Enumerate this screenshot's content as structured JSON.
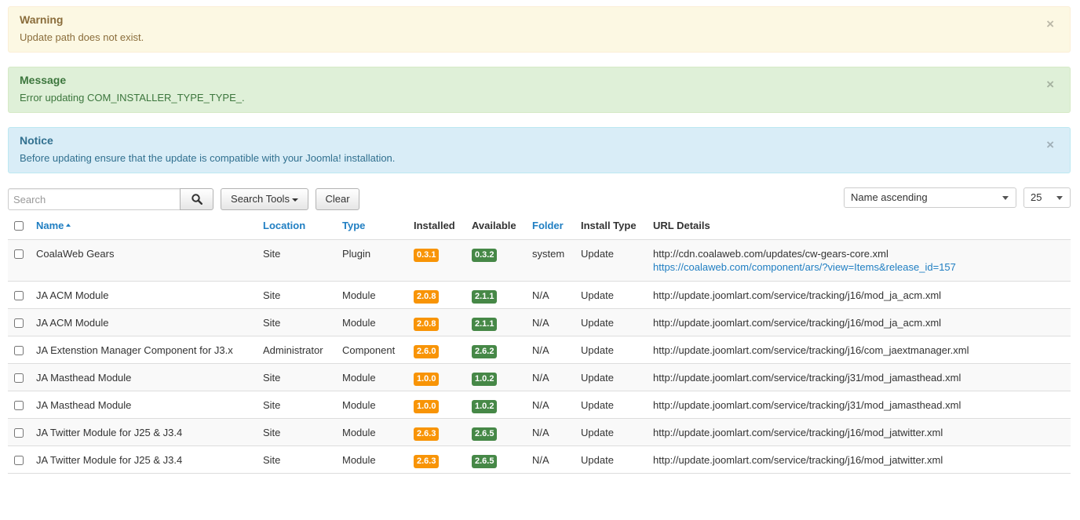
{
  "alerts": {
    "warning": {
      "title": "Warning",
      "text": "Update path does not exist.",
      "close": "×"
    },
    "message": {
      "title": "Message",
      "text": "Error updating COM_INSTALLER_TYPE_TYPE_.",
      "close": "×"
    },
    "notice": {
      "title": "Notice",
      "text": "Before updating ensure that the update is compatible with your Joomla! installation.",
      "close": "×"
    }
  },
  "toolbar": {
    "search_placeholder": "Search",
    "search_tools_label": "Search Tools",
    "clear_label": "Clear",
    "ordering_value": "Name ascending",
    "limit_value": "25"
  },
  "table": {
    "headers": {
      "name": "Name",
      "location": "Location",
      "type": "Type",
      "installed": "Installed",
      "available": "Available",
      "folder": "Folder",
      "install_type": "Install Type",
      "url_details": "URL Details"
    },
    "rows": [
      {
        "name": "CoalaWeb Gears",
        "location": "Site",
        "type": "Plugin",
        "installed": "0.3.1",
        "available": "0.3.2",
        "folder": "system",
        "install_type": "Update",
        "url": "http://cdn.coalaweb.com/updates/cw-gears-core.xml",
        "url2": "https://coalaweb.com/component/ars/?view=Items&release_id=157"
      },
      {
        "name": "JA ACM Module",
        "location": "Site",
        "type": "Module",
        "installed": "2.0.8",
        "available": "2.1.1",
        "folder": "N/A",
        "install_type": "Update",
        "url": "http://update.joomlart.com/service/tracking/j16/mod_ja_acm.xml"
      },
      {
        "name": "JA ACM Module",
        "location": "Site",
        "type": "Module",
        "installed": "2.0.8",
        "available": "2.1.1",
        "folder": "N/A",
        "install_type": "Update",
        "url": "http://update.joomlart.com/service/tracking/j16/mod_ja_acm.xml"
      },
      {
        "name": "JA Extenstion Manager Component for J3.x",
        "location": "Administrator",
        "type": "Component",
        "installed": "2.6.0",
        "available": "2.6.2",
        "folder": "N/A",
        "install_type": "Update",
        "url": "http://update.joomlart.com/service/tracking/j16/com_jaextmanager.xml"
      },
      {
        "name": "JA Masthead Module",
        "location": "Site",
        "type": "Module",
        "installed": "1.0.0",
        "available": "1.0.2",
        "folder": "N/A",
        "install_type": "Update",
        "url": "http://update.joomlart.com/service/tracking/j31/mod_jamasthead.xml"
      },
      {
        "name": "JA Masthead Module",
        "location": "Site",
        "type": "Module",
        "installed": "1.0.0",
        "available": "1.0.2",
        "folder": "N/A",
        "install_type": "Update",
        "url": "http://update.joomlart.com/service/tracking/j31/mod_jamasthead.xml"
      },
      {
        "name": "JA Twitter Module for J25 & J3.4",
        "location": "Site",
        "type": "Module",
        "installed": "2.6.3",
        "available": "2.6.5",
        "folder": "N/A",
        "install_type": "Update",
        "url": "http://update.joomlart.com/service/tracking/j16/mod_jatwitter.xml"
      },
      {
        "name": "JA Twitter Module for J25 & J3.4",
        "location": "Site",
        "type": "Module",
        "installed": "2.6.3",
        "available": "2.6.5",
        "folder": "N/A",
        "install_type": "Update",
        "url": "http://update.joomlart.com/service/tracking/j16/mod_jatwitter.xml"
      }
    ]
  },
  "colors": {
    "installed_badge": "#f89406",
    "available_badge": "#468847",
    "link": "#1f7ec2"
  }
}
